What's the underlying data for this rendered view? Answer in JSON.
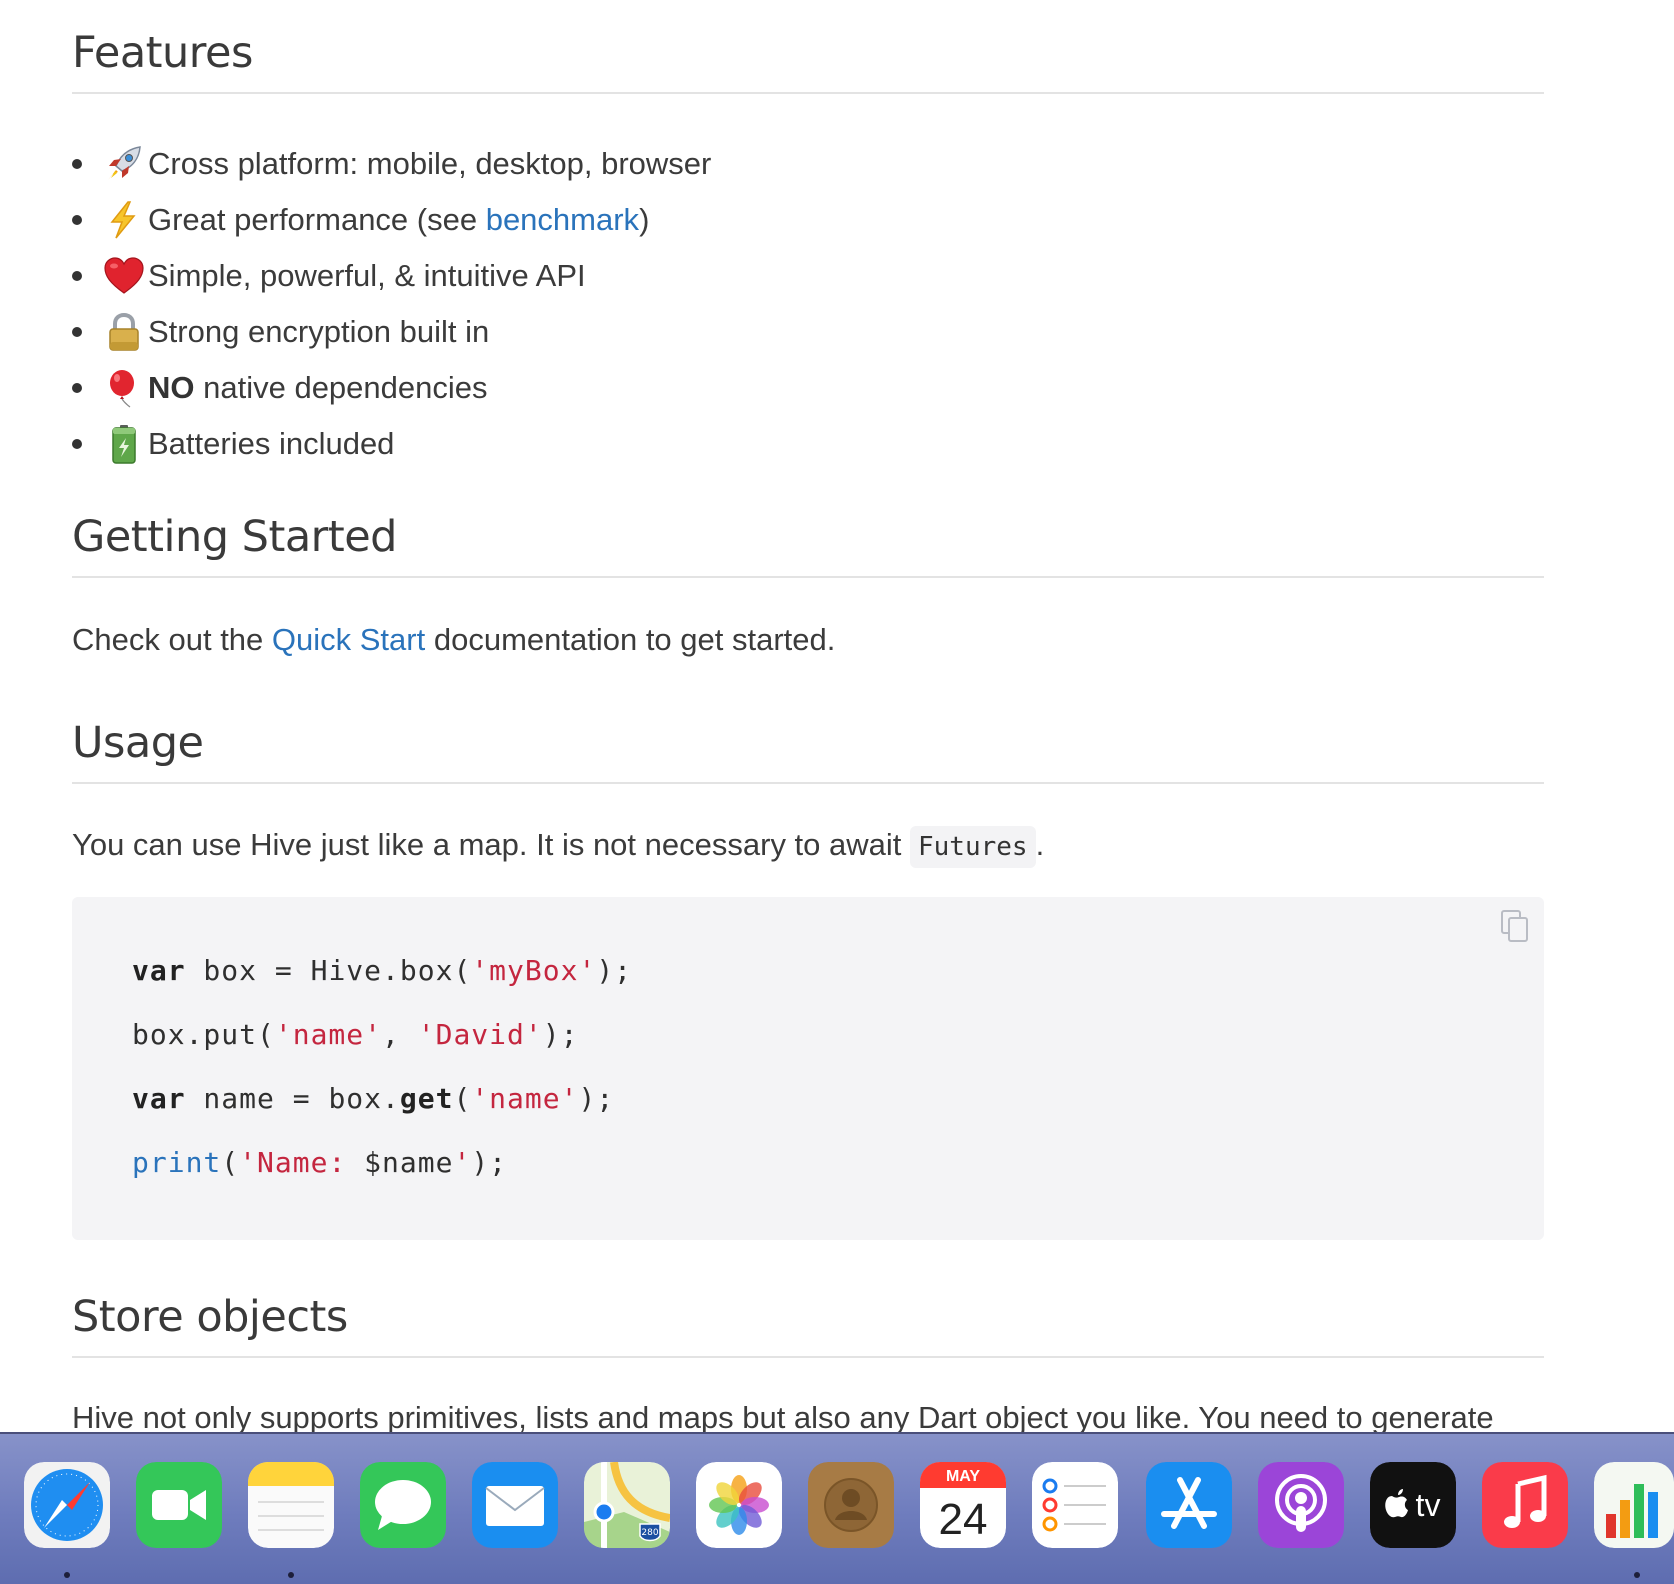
{
  "sections": {
    "features": {
      "heading": "Features",
      "items": [
        {
          "icon": "rocket-icon",
          "text": "Cross platform: mobile, desktop, browser"
        },
        {
          "icon": "lightning-icon",
          "text_before": "Great performance (see ",
          "link": "benchmark",
          "text_after": ")"
        },
        {
          "icon": "heart-icon",
          "text": "Simple, powerful, & intuitive API"
        },
        {
          "icon": "lock-icon",
          "text": "Strong encryption built in"
        },
        {
          "icon": "balloon-icon",
          "bold": "NO",
          "text": " native dependencies"
        },
        {
          "icon": "battery-icon",
          "text": "Batteries included"
        }
      ]
    },
    "getting_started": {
      "heading": "Getting Started",
      "text_before": "Check out the ",
      "link": "Quick Start",
      "text_after": " documentation to get started."
    },
    "usage": {
      "heading": "Usage",
      "text_before": "You can use Hive just like a map. It is not necessary to await ",
      "inline_code": "Futures",
      "text_after": ".",
      "code": {
        "line1": {
          "kw": "var",
          "a": " box = Hive.box(",
          "s": "'myBox'",
          "b": ");"
        },
        "line2": {
          "a": "box.put(",
          "s1": "'name'",
          "mid": ", ",
          "s2": "'David'",
          "b": ");"
        },
        "line3": {
          "kw": "var",
          "a": " name = box.",
          "kw2": "get",
          "p": "(",
          "s": "'name'",
          "b": ");"
        },
        "line4": {
          "fn": "print",
          "p": "(",
          "s1": "'Name: ",
          "v": "$name",
          "s2": "'",
          "b": ");"
        }
      }
    },
    "store_objects": {
      "heading": "Store objects",
      "text": "Hive not only supports primitives, lists and maps but also any Dart object you like. You need to generate"
    }
  },
  "dock": {
    "apps": [
      {
        "name": "Safari",
        "icon": "safari-icon",
        "running": true
      },
      {
        "name": "FaceTime",
        "icon": "facetime-icon",
        "running": false
      },
      {
        "name": "Notes",
        "icon": "notes-icon",
        "running": true
      },
      {
        "name": "Messages",
        "icon": "messages-icon",
        "running": false
      },
      {
        "name": "Mail",
        "icon": "mail-icon",
        "running": false
      },
      {
        "name": "Maps",
        "icon": "maps-icon",
        "running": false,
        "badge": "280"
      },
      {
        "name": "Photos",
        "icon": "photos-icon",
        "running": false
      },
      {
        "name": "Contacts",
        "icon": "contacts-icon",
        "running": false
      },
      {
        "name": "Calendar",
        "icon": "calendar-icon",
        "running": false,
        "month": "MAY",
        "day": "24"
      },
      {
        "name": "Reminders",
        "icon": "reminders-icon",
        "running": false
      },
      {
        "name": "App Store",
        "icon": "app-store-icon",
        "running": false
      },
      {
        "name": "Podcasts",
        "icon": "podcasts-icon",
        "running": false
      },
      {
        "name": "TV",
        "icon": "tv-icon",
        "running": false,
        "label": "tv"
      },
      {
        "name": "Music",
        "icon": "music-icon",
        "running": false
      },
      {
        "name": "Numbers",
        "icon": "numbers-icon",
        "running": true
      }
    ]
  },
  "colors": {
    "link": "#2a73bb",
    "string": "#c4263f",
    "code_bg": "#f4f4f6"
  }
}
